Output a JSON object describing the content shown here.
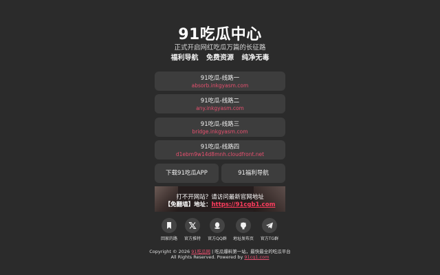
{
  "header": {
    "title": "91吃瓜中心",
    "subtitle": "正式开启网红吃瓜万篇的长征路",
    "tags": [
      "福利导航",
      "免费资源",
      "纯净无毒"
    ]
  },
  "routes": [
    {
      "name": "91吃瓜-线路一",
      "url": "absorb.inkgyasm.com"
    },
    {
      "name": "91吃瓜-线路二",
      "url": "any.inkgyasm.com"
    },
    {
      "name": "91吃瓜-线路三",
      "url": "bridge.inkgyasm.com"
    },
    {
      "name": "91吃瓜-线路四",
      "url": "d1ebm9w14d8mnh.cloudfront.net"
    }
  ],
  "buttons": {
    "download_app": "下载91吃瓜APP",
    "nav": "91福利导航"
  },
  "banner": {
    "line1": "打不开网站？请访问最新官网地址",
    "line2_prefix": "【免翻墙】地址：",
    "line2_link": "https://91cgb1.com"
  },
  "social": [
    {
      "icon": "bookmark-icon",
      "label": "回家的路"
    },
    {
      "icon": "x-twitter-icon",
      "label": "官方推特"
    },
    {
      "icon": "qq-icon",
      "label": "官方QQ群"
    },
    {
      "icon": "github-icon",
      "label": "地址发布页"
    },
    {
      "icon": "telegram-icon",
      "label": "官方TG群"
    }
  ],
  "footer": {
    "copyright_prefix": "Copyright © 2026 ",
    "copyright_link": "91吃瓜网",
    "copyright_suffix": " | 吃瓜爆料第一站，最快最全的吃瓜平台",
    "rights_prefix": "All Rights Reserved. Powered by ",
    "rights_link": "91cg1.com"
  },
  "colors": {
    "background": "#2b2b2b",
    "card": "#3d3d3d",
    "accent": "#e8506f"
  }
}
